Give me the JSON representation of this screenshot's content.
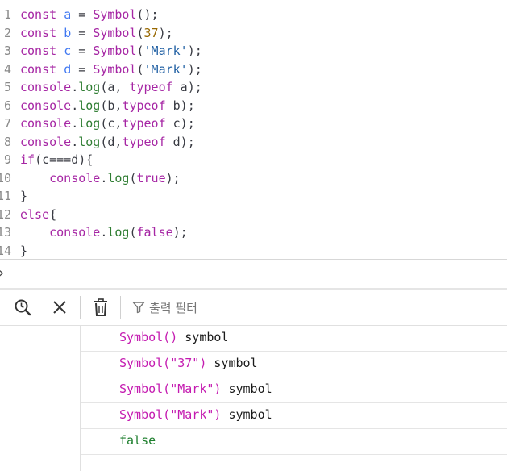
{
  "editor": {
    "line_numbers": [
      "1",
      "2",
      "3",
      "4",
      "5",
      "6",
      "7",
      "8",
      "9",
      "10",
      "11",
      "12",
      "13",
      "14"
    ],
    "lines": [
      [
        {
          "t": "const ",
          "c": "kw"
        },
        {
          "t": "a",
          "c": "var"
        },
        {
          "t": " = ",
          "c": "plain"
        },
        {
          "t": "Symbol",
          "c": "kw"
        },
        {
          "t": "();",
          "c": "plain"
        }
      ],
      [
        {
          "t": "const ",
          "c": "kw"
        },
        {
          "t": "b",
          "c": "var"
        },
        {
          "t": " = ",
          "c": "plain"
        },
        {
          "t": "Symbol",
          "c": "kw"
        },
        {
          "t": "(",
          "c": "plain"
        },
        {
          "t": "37",
          "c": "num"
        },
        {
          "t": ");",
          "c": "plain"
        }
      ],
      [
        {
          "t": "const ",
          "c": "kw"
        },
        {
          "t": "c",
          "c": "var"
        },
        {
          "t": " = ",
          "c": "plain"
        },
        {
          "t": "Symbol",
          "c": "kw"
        },
        {
          "t": "(",
          "c": "plain"
        },
        {
          "t": "'Mark'",
          "c": "str"
        },
        {
          "t": ");",
          "c": "plain"
        }
      ],
      [
        {
          "t": "const ",
          "c": "kw"
        },
        {
          "t": "d",
          "c": "var"
        },
        {
          "t": " = ",
          "c": "plain"
        },
        {
          "t": "Symbol",
          "c": "kw"
        },
        {
          "t": "(",
          "c": "plain"
        },
        {
          "t": "'Mark'",
          "c": "str"
        },
        {
          "t": ");",
          "c": "plain"
        }
      ],
      [
        {
          "t": "console",
          "c": "kw"
        },
        {
          "t": ".",
          "c": "plain"
        },
        {
          "t": "log",
          "c": "method"
        },
        {
          "t": "(a, ",
          "c": "plain"
        },
        {
          "t": "typeof",
          "c": "kw"
        },
        {
          "t": " a);",
          "c": "plain"
        }
      ],
      [
        {
          "t": "console",
          "c": "kw"
        },
        {
          "t": ".",
          "c": "plain"
        },
        {
          "t": "log",
          "c": "method"
        },
        {
          "t": "(b,",
          "c": "plain"
        },
        {
          "t": "typeof",
          "c": "kw"
        },
        {
          "t": " b);",
          "c": "plain"
        }
      ],
      [
        {
          "t": "console",
          "c": "kw"
        },
        {
          "t": ".",
          "c": "plain"
        },
        {
          "t": "log",
          "c": "method"
        },
        {
          "t": "(c,",
          "c": "plain"
        },
        {
          "t": "typeof",
          "c": "kw"
        },
        {
          "t": " c);",
          "c": "plain"
        }
      ],
      [
        {
          "t": "console",
          "c": "kw"
        },
        {
          "t": ".",
          "c": "plain"
        },
        {
          "t": "log",
          "c": "method"
        },
        {
          "t": "(d,",
          "c": "plain"
        },
        {
          "t": "typeof",
          "c": "kw"
        },
        {
          "t": " d);",
          "c": "plain"
        }
      ],
      [
        {
          "t": "if",
          "c": "kw"
        },
        {
          "t": "(c===d){",
          "c": "plain"
        }
      ],
      [
        {
          "t": "    console",
          "c": "kw"
        },
        {
          "t": ".",
          "c": "plain"
        },
        {
          "t": "log",
          "c": "method"
        },
        {
          "t": "(",
          "c": "plain"
        },
        {
          "t": "true",
          "c": "kw"
        },
        {
          "t": ");",
          "c": "plain"
        }
      ],
      [
        {
          "t": "}",
          "c": "plain"
        }
      ],
      [
        {
          "t": "else",
          "c": "kw"
        },
        {
          "t": "{",
          "c": "plain"
        }
      ],
      [
        {
          "t": "    console",
          "c": "kw"
        },
        {
          "t": ".",
          "c": "plain"
        },
        {
          "t": "log",
          "c": "method"
        },
        {
          "t": "(",
          "c": "plain"
        },
        {
          "t": "false",
          "c": "kw"
        },
        {
          "t": ");",
          "c": "plain"
        }
      ],
      [
        {
          "t": "}",
          "c": "plain"
        }
      ]
    ]
  },
  "prompt": {
    "arrow": "›"
  },
  "toolbar": {
    "icons": [
      "search-history-icon",
      "clear-icon",
      "trash-icon",
      "filter-icon"
    ],
    "filter_placeholder": "출력 필터"
  },
  "console_output": [
    [
      {
        "t": "Symbol()",
        "c": "sym"
      },
      {
        "t": " symbol",
        "c": "typ"
      }
    ],
    [
      {
        "t": "Symbol(\"37\")",
        "c": "sym"
      },
      {
        "t": " symbol",
        "c": "typ"
      }
    ],
    [
      {
        "t": "Symbol(\"Mark\")",
        "c": "sym"
      },
      {
        "t": " symbol",
        "c": "typ"
      }
    ],
    [
      {
        "t": "Symbol(\"Mark\")",
        "c": "sym"
      },
      {
        "t": " symbol",
        "c": "typ"
      }
    ],
    [
      {
        "t": "false",
        "c": "bool"
      }
    ]
  ],
  "colors": {
    "keyword": "#a626a4",
    "variable": "#4078f2",
    "string": "#1f5fa3",
    "method": "#2f7d32",
    "symbol_output": "#c41ab0",
    "bool_output": "#1e7f2e"
  }
}
